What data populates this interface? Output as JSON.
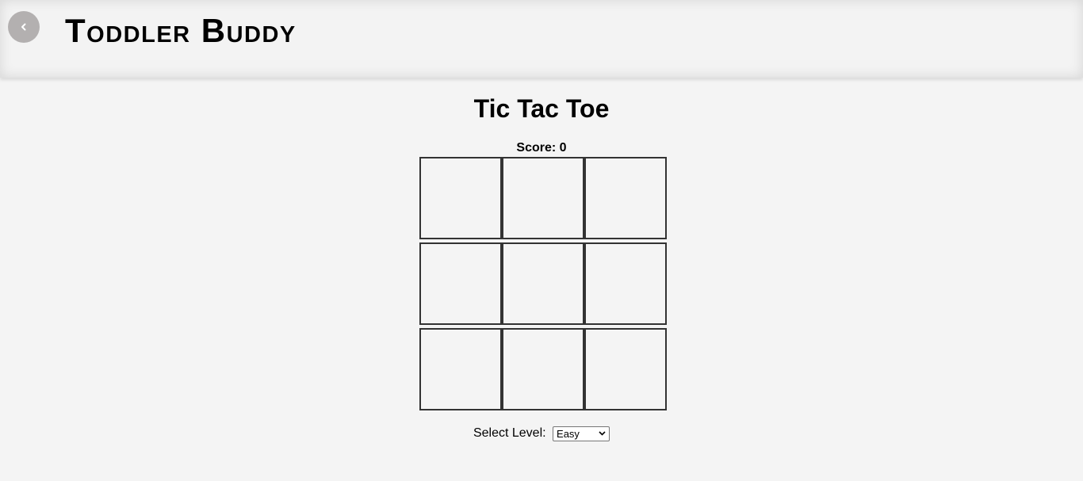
{
  "header": {
    "brand_title": "Toddler Buddy",
    "back_icon": "chevron-left-icon"
  },
  "game": {
    "title": "Tic Tac Toe",
    "score_label": "Score: 0",
    "board": [
      [
        "",
        "",
        ""
      ],
      [
        "",
        "",
        ""
      ],
      [
        "",
        "",
        ""
      ]
    ]
  },
  "level": {
    "label": "Select Level:",
    "selected": "Easy"
  },
  "colors": {
    "background": "#f4f4f4",
    "back_button": "#b3b0b0",
    "cell_border": "#333333"
  }
}
